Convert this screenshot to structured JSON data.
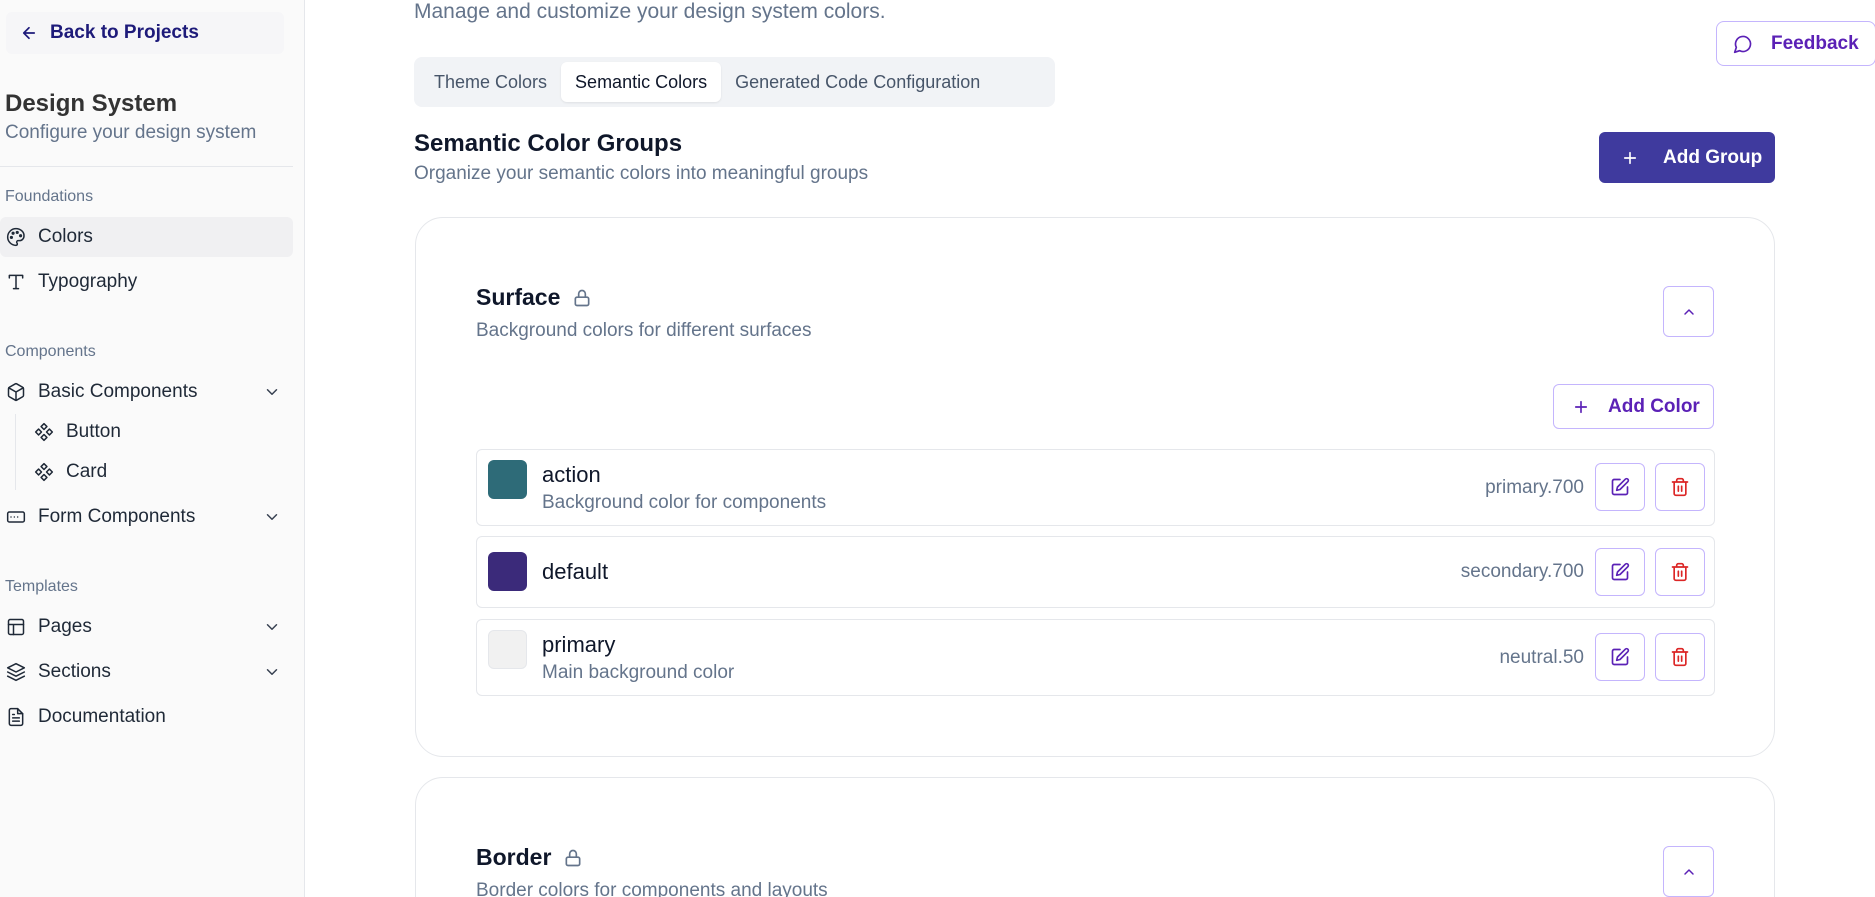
{
  "sidebar": {
    "back_label": "Back to Projects",
    "title": "Design System",
    "subtitle": "Configure your design system",
    "sections": {
      "foundations": "Foundations",
      "components": "Components",
      "templates": "Templates"
    },
    "items": {
      "colors": "Colors",
      "typography": "Typography",
      "basic_components": "Basic Components",
      "button": "Button",
      "card": "Card",
      "form_components": "Form Components",
      "pages": "Pages",
      "sections": "Sections",
      "documentation": "Documentation"
    }
  },
  "main": {
    "page_subtitle": "Manage and customize your design system colors.",
    "feedback_label": "Feedback",
    "tabs": [
      {
        "label": "Theme Colors",
        "active": false
      },
      {
        "label": "Semantic Colors",
        "active": true
      },
      {
        "label": "Generated Code Configuration",
        "active": false
      }
    ],
    "groups_title": "Semantic Color Groups",
    "groups_subtitle": "Organize your semantic colors into meaningful groups",
    "add_group_label": "Add Group",
    "groups": [
      {
        "name": "Surface",
        "description": "Background colors for different surfaces",
        "add_color_label": "Add Color",
        "colors": [
          {
            "name": "action",
            "description": "Background color for components",
            "token": "primary.700",
            "swatch": "#2e6b78"
          },
          {
            "name": "default",
            "description": "",
            "token": "secondary.700",
            "swatch": "#3b2a7a"
          },
          {
            "name": "primary",
            "description": "Main background color",
            "token": "neutral.50",
            "swatch": "#f1f1f1"
          }
        ]
      },
      {
        "name": "Border",
        "description": "Border colors for components and layouts"
      }
    ]
  },
  "colors": {
    "accent": "#3f3a9e",
    "accent_text": "#5b21b6",
    "danger": "#dc2626"
  }
}
